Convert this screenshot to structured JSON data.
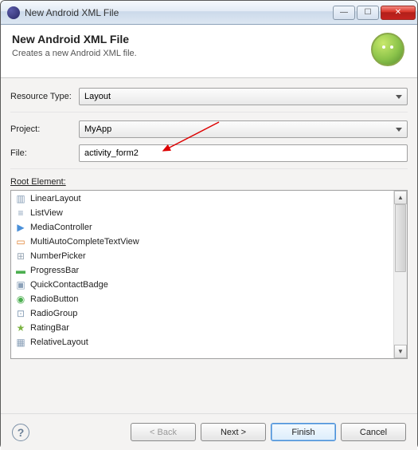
{
  "window": {
    "title": "New Android XML File"
  },
  "header": {
    "title": "New Android XML File",
    "subtitle": "Creates a new Android XML file."
  },
  "form": {
    "resource_type_label": "Resource Type:",
    "resource_type_value": "Layout",
    "project_label": "Project:",
    "project_value": "MyApp",
    "file_label": "File:",
    "file_value": "activity_form2",
    "root_label": "Root Element:"
  },
  "root_elements": [
    {
      "icon": "▥",
      "color": "#8aa0b8",
      "label": "LinearLayout"
    },
    {
      "icon": "≡",
      "color": "#8aa0b8",
      "label": "ListView"
    },
    {
      "icon": "▶",
      "color": "#4a90d9",
      "label": "MediaController"
    },
    {
      "icon": "▭",
      "color": "#e08030",
      "label": "MultiAutoCompleteTextView"
    },
    {
      "icon": "⊞",
      "color": "#9aa8b6",
      "label": "NumberPicker"
    },
    {
      "icon": "▬",
      "color": "#4caf50",
      "label": "ProgressBar"
    },
    {
      "icon": "▣",
      "color": "#8aa0b8",
      "label": "QuickContactBadge"
    },
    {
      "icon": "◉",
      "color": "#4caf50",
      "label": "RadioButton"
    },
    {
      "icon": "⊡",
      "color": "#8aa0b8",
      "label": "RadioGroup"
    },
    {
      "icon": "★",
      "color": "#7cb342",
      "label": "RatingBar"
    },
    {
      "icon": "▦",
      "color": "#8aa0b8",
      "label": "RelativeLayout"
    }
  ],
  "buttons": {
    "back": "< Back",
    "next": "Next >",
    "finish": "Finish",
    "cancel": "Cancel"
  }
}
